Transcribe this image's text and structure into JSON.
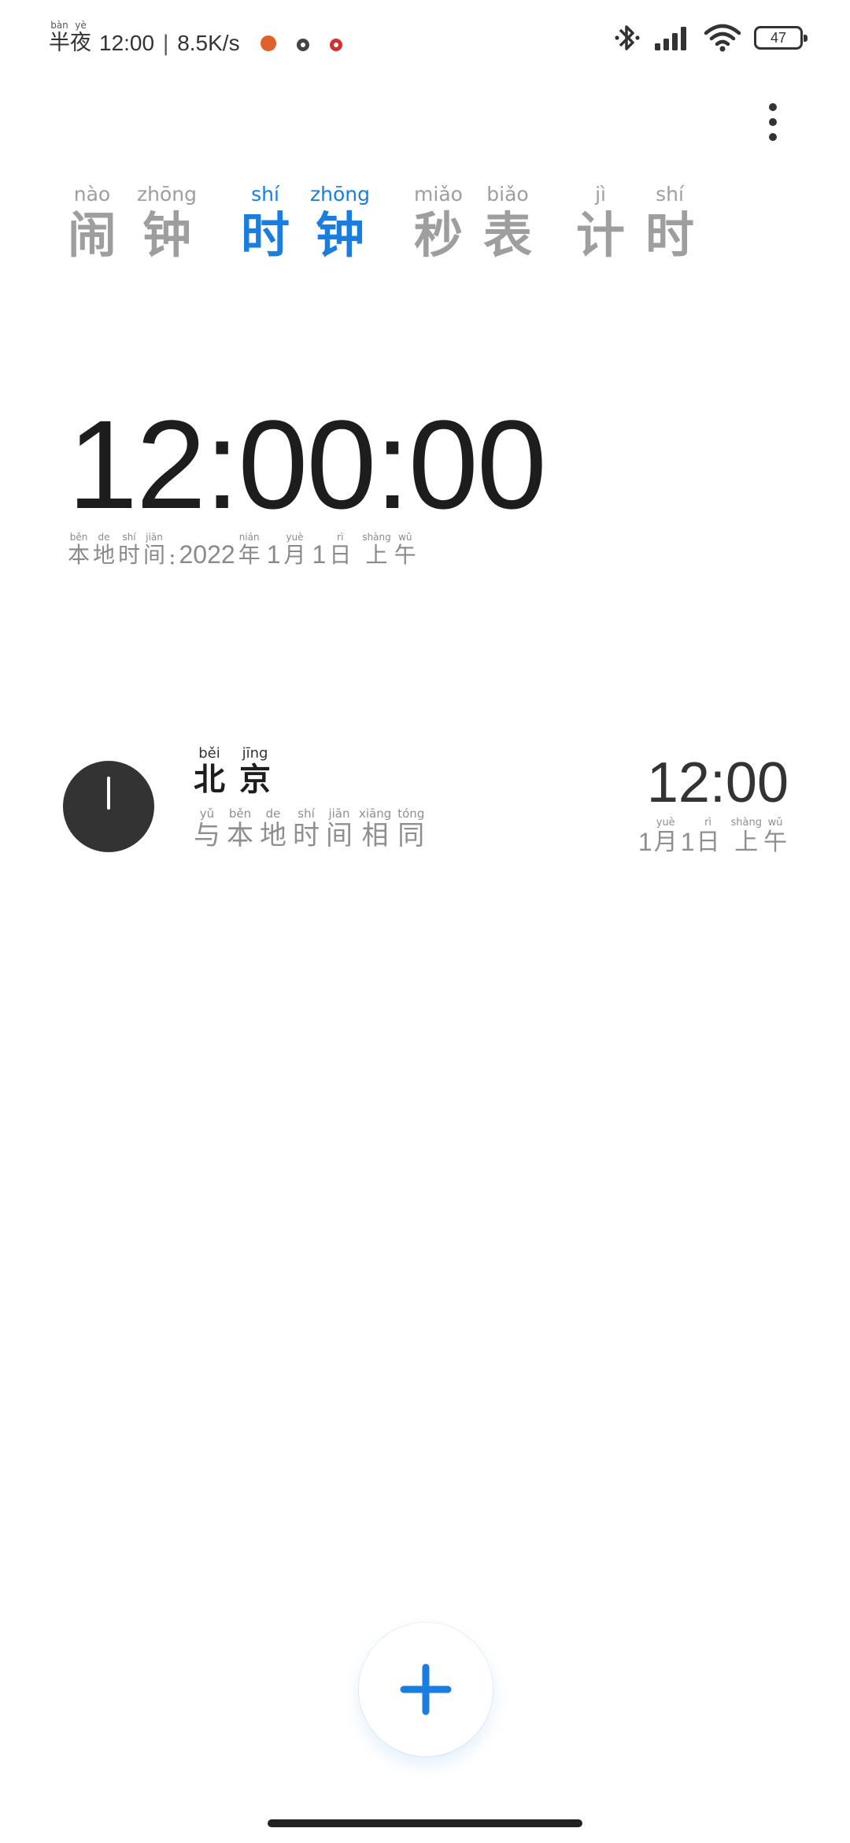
{
  "status_bar": {
    "period": [
      {
        "hanzi": "半",
        "pinyin": "bàn"
      },
      {
        "hanzi": "夜",
        "pinyin": "yè"
      }
    ],
    "time": "12:00",
    "separator": "|",
    "network_speed": "8.5K/s",
    "battery_level": "47",
    "icons": [
      "app-notification-icon",
      "weather-icon",
      "camera-notification-icon",
      "bluetooth-icon",
      "cellular-signal-icon",
      "wifi-icon",
      "battery-icon"
    ]
  },
  "tabs": [
    {
      "chars": [
        {
          "hanzi": "闹",
          "pinyin": "nào"
        },
        {
          "hanzi": "钟",
          "pinyin": "zhōng"
        }
      ],
      "active": false
    },
    {
      "chars": [
        {
          "hanzi": "时",
          "pinyin": "shí"
        },
        {
          "hanzi": "钟",
          "pinyin": "zhōng"
        }
      ],
      "active": true
    },
    {
      "chars": [
        {
          "hanzi": "秒",
          "pinyin": "miǎo"
        },
        {
          "hanzi": "表",
          "pinyin": "biǎo"
        }
      ],
      "active": false
    },
    {
      "chars": [
        {
          "hanzi": "计",
          "pinyin": "jì"
        },
        {
          "hanzi": "时",
          "pinyin": "shí"
        }
      ],
      "active": false
    }
  ],
  "main_clock": {
    "time": "12:00:00",
    "local_label": [
      {
        "hanzi": "本",
        "pinyin": "běn"
      },
      {
        "hanzi": "地",
        "pinyin": "de"
      },
      {
        "hanzi": "时",
        "pinyin": "shí"
      },
      {
        "hanzi": "间",
        "pinyin": "jiān"
      }
    ],
    "colon": ":",
    "year": "2022",
    "year_char": {
      "hanzi": "年",
      "pinyin": "nián"
    },
    "month": "1",
    "month_char": {
      "hanzi": "月",
      "pinyin": "yuè"
    },
    "day": "1",
    "day_char": {
      "hanzi": "日",
      "pinyin": "rì"
    },
    "ampm": [
      {
        "hanzi": "上",
        "pinyin": "shàng"
      },
      {
        "hanzi": "午",
        "pinyin": "wǔ"
      }
    ]
  },
  "world_clock": {
    "city": [
      {
        "hanzi": "北",
        "pinyin": "běi"
      },
      {
        "hanzi": "京",
        "pinyin": "jīng"
      }
    ],
    "difference": [
      {
        "hanzi": "与",
        "pinyin": "yǔ"
      },
      {
        "hanzi": "本",
        "pinyin": "běn"
      },
      {
        "hanzi": "地",
        "pinyin": "de"
      },
      {
        "hanzi": "时",
        "pinyin": "shí"
      },
      {
        "hanzi": "间",
        "pinyin": "jiān"
      },
      {
        "hanzi": "相",
        "pinyin": "xiāng"
      },
      {
        "hanzi": "同",
        "pinyin": "tóng"
      }
    ],
    "time": "12:00",
    "month": "1",
    "month_char": {
      "hanzi": "月",
      "pinyin": "yuè"
    },
    "day": "1",
    "day_char": {
      "hanzi": "日",
      "pinyin": "rì"
    },
    "ampm": [
      {
        "hanzi": "上",
        "pinyin": "shàng"
      },
      {
        "hanzi": "午",
        "pinyin": "wǔ"
      }
    ]
  },
  "colors": {
    "accent": "#1a7ee0",
    "inactive_tab": "#9e9e9e",
    "clock_face": "#333333",
    "app_icon_orange": "#e0622a",
    "app_icon_dark": "#444444",
    "app_icon_red": "#d3312f"
  }
}
